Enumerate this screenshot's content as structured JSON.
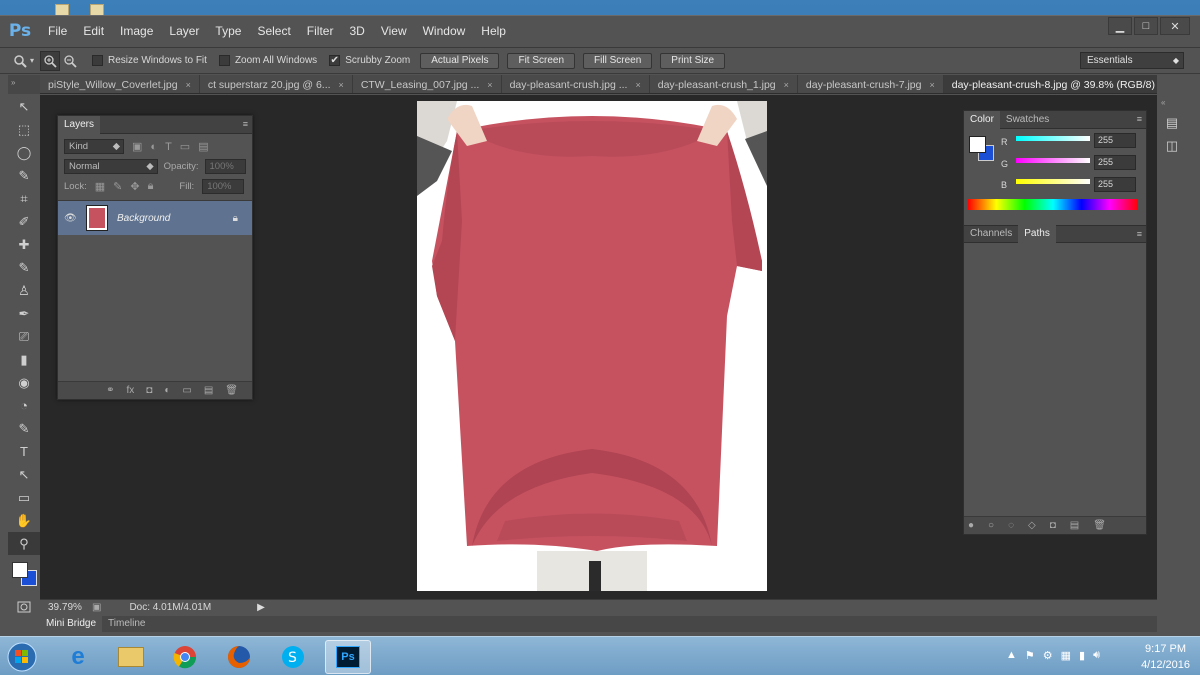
{
  "app": {
    "logo": "Ps"
  },
  "menu": [
    "File",
    "Edit",
    "Image",
    "Layer",
    "Type",
    "Select",
    "Filter",
    "3D",
    "View",
    "Window",
    "Help"
  ],
  "window_buttons": {
    "minimize": "▁",
    "maximize": "□",
    "close": "✕"
  },
  "options": {
    "resize_windows": "Resize Windows to Fit",
    "zoom_all": "Zoom All Windows",
    "scrubby": "Scrubby Zoom",
    "scrubby_checked": "✔",
    "actual": "Actual Pixels",
    "fit": "Fit Screen",
    "fill": "Fill Screen",
    "print": "Print Size",
    "workspace": "Essentials"
  },
  "tabs": [
    {
      "label": "piStyle_Willow_Coverlet.jpg"
    },
    {
      "label": "ct superstarz 20.jpg @ 6..."
    },
    {
      "label": "CTW_Leasing_007.jpg ..."
    },
    {
      "label": "day-pleasant-crush.jpg ..."
    },
    {
      "label": "day-pleasant-crush_1.jpg"
    },
    {
      "label": "day-pleasant-crush-7.jpg"
    },
    {
      "label": "day-pleasant-crush-8.jpg @ 39.8% (RGB/8)"
    }
  ],
  "tools": [
    "↖",
    "⬚",
    "◯",
    "✎",
    "⌗",
    "✐",
    "✚",
    "✎",
    "♙",
    "✒",
    "⎚",
    "▮",
    "◉",
    "◔",
    "✎",
    "T",
    "↖",
    "▭",
    "✋",
    "⚲"
  ],
  "layers": {
    "tab": "Layers",
    "kind": "Kind",
    "blend": "Normal",
    "opacity_label": "Opacity:",
    "opacity": "100%",
    "lock_label": "Lock:",
    "fill_label": "Fill:",
    "fill": "100%",
    "layer_name": "Background",
    "footer_icons": [
      "⚭",
      "fx",
      "◘",
      "◐",
      "▭",
      "▤",
      "🗑"
    ]
  },
  "color": {
    "tab": "Color",
    "tab2": "Swatches",
    "r_label": "R",
    "r": "255",
    "g_label": "G",
    "g": "255",
    "b_label": "B",
    "b": "255"
  },
  "paths": {
    "tab1": "Channels",
    "tab2": "Paths"
  },
  "status": {
    "zoom": "39.79%",
    "doc": "Doc: 4.01M/4.01M"
  },
  "bottom_tabs": [
    "Mini Bridge",
    "Timeline"
  ],
  "clock": {
    "time": "9:17 PM",
    "date": "4/12/2016"
  }
}
